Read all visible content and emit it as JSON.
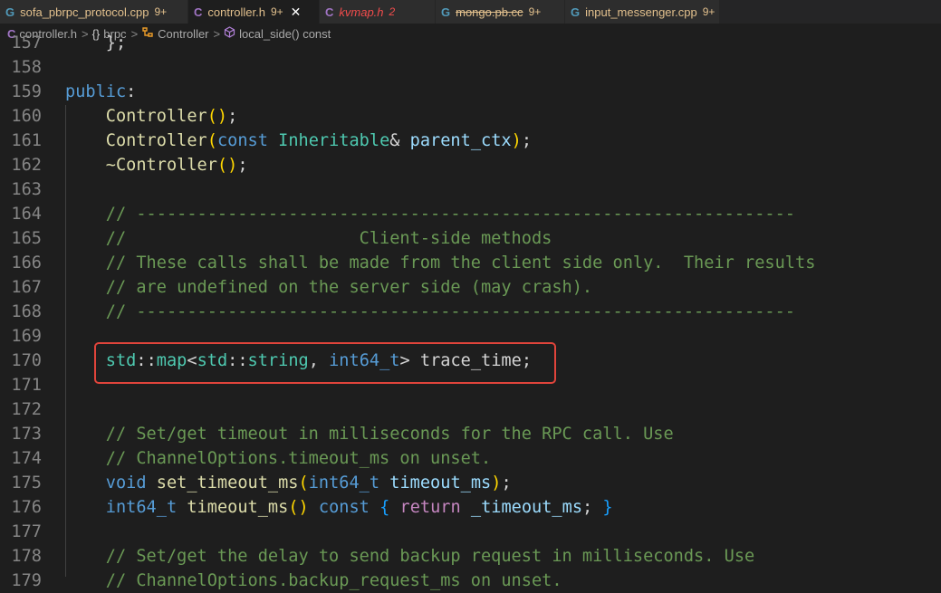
{
  "tabs": [
    {
      "icon": "G",
      "label": "sofa_pbrpc_protocol.cpp",
      "badge": "9+",
      "color": "#e2c08d",
      "icon_color": "#519aba",
      "active": false
    },
    {
      "icon": "C",
      "label": "controller.h",
      "badge": "9+",
      "color": "#e2c08d",
      "icon_color": "#a074c4",
      "active": true,
      "close": "✕"
    },
    {
      "icon": "C",
      "label": "kvmap.h",
      "badge": "2",
      "color": "#f14c4c",
      "icon_color": "#a074c4",
      "italic": true
    },
    {
      "icon": "G",
      "label": "mongo.pb.cc",
      "badge": "9+",
      "color": "#e2c08d",
      "icon_color": "#519aba",
      "strike": true
    },
    {
      "icon": "G",
      "label": "input_messenger.cpp",
      "badge": "9+",
      "color": "#e2c08d",
      "icon_color": "#519aba"
    }
  ],
  "breadcrumb": {
    "file_icon": "C",
    "file": "controller.h",
    "namespace_icon": "{}",
    "namespace": "brpc",
    "class": "Controller",
    "method": "local_side() const",
    "sep": ">"
  },
  "editor": {
    "lines": [
      {
        "n": "157",
        "code": [
          [
            "    ",
            "pu"
          ],
          [
            "};",
            "pu"
          ]
        ]
      },
      {
        "n": "158",
        "code": []
      },
      {
        "n": "159",
        "code": [
          [
            "public",
            "kw"
          ],
          [
            ":",
            "pu"
          ]
        ]
      },
      {
        "n": "160",
        "code": [
          [
            "    ",
            "pu"
          ],
          [
            "Controller",
            "fn"
          ],
          [
            "()",
            "br1"
          ],
          [
            ";",
            "pu"
          ]
        ]
      },
      {
        "n": "161",
        "code": [
          [
            "    ",
            "pu"
          ],
          [
            "Controller",
            "fn"
          ],
          [
            "(",
            "br1"
          ],
          [
            "const",
            "kw"
          ],
          [
            " ",
            "pu"
          ],
          [
            "Inheritable",
            "ty"
          ],
          [
            "& ",
            "pu"
          ],
          [
            "parent_ctx",
            "pm"
          ],
          [
            ")",
            "br1"
          ],
          [
            ";",
            "pu"
          ]
        ]
      },
      {
        "n": "162",
        "code": [
          [
            "    ",
            "pu"
          ],
          [
            "~Controller",
            "fn"
          ],
          [
            "()",
            "br1"
          ],
          [
            ";",
            "pu"
          ]
        ]
      },
      {
        "n": "163",
        "code": []
      },
      {
        "n": "164",
        "code": [
          [
            "    ",
            "pu"
          ],
          [
            "// -----------------------------------------------------------------",
            "cm"
          ]
        ]
      },
      {
        "n": "165",
        "code": [
          [
            "    ",
            "pu"
          ],
          [
            "//                       Client-side methods",
            "cm"
          ]
        ]
      },
      {
        "n": "166",
        "code": [
          [
            "    ",
            "pu"
          ],
          [
            "// These calls shall be made from the client side only.  Their results",
            "cm"
          ]
        ]
      },
      {
        "n": "167",
        "code": [
          [
            "    ",
            "pu"
          ],
          [
            "// are undefined on the server side (may crash).",
            "cm"
          ]
        ]
      },
      {
        "n": "168",
        "code": [
          [
            "    ",
            "pu"
          ],
          [
            "// -----------------------------------------------------------------",
            "cm"
          ]
        ]
      },
      {
        "n": "169",
        "code": []
      },
      {
        "n": "170",
        "code": [
          [
            "    ",
            "pu"
          ],
          [
            "std",
            "ty"
          ],
          [
            "::",
            "pu"
          ],
          [
            "map",
            "ty"
          ],
          [
            "<",
            "pu"
          ],
          [
            "std",
            "ty"
          ],
          [
            "::",
            "pu"
          ],
          [
            "string",
            "ty"
          ],
          [
            ", ",
            "pu"
          ],
          [
            "int64_t",
            "kw"
          ],
          [
            "> ",
            "pu"
          ],
          [
            "trace_time",
            "pu"
          ],
          [
            ";",
            "pu"
          ]
        ]
      },
      {
        "n": "171",
        "code": []
      },
      {
        "n": "172",
        "code": []
      },
      {
        "n": "173",
        "code": [
          [
            "    ",
            "pu"
          ],
          [
            "// Set/get timeout in milliseconds for the RPC call. Use",
            "cm"
          ]
        ]
      },
      {
        "n": "174",
        "code": [
          [
            "    ",
            "pu"
          ],
          [
            "// ChannelOptions.timeout_ms on unset.",
            "cm"
          ]
        ]
      },
      {
        "n": "175",
        "code": [
          [
            "    ",
            "pu"
          ],
          [
            "void",
            "kw"
          ],
          [
            " ",
            "pu"
          ],
          [
            "set_timeout_ms",
            "fn"
          ],
          [
            "(",
            "br1"
          ],
          [
            "int64_t",
            "kw"
          ],
          [
            " ",
            "pu"
          ],
          [
            "timeout_ms",
            "pm"
          ],
          [
            ")",
            "br1"
          ],
          [
            ";",
            "pu"
          ]
        ]
      },
      {
        "n": "176",
        "code": [
          [
            "    ",
            "pu"
          ],
          [
            "int64_t",
            "kw"
          ],
          [
            " ",
            "pu"
          ],
          [
            "timeout_ms",
            "fn"
          ],
          [
            "()",
            "br1"
          ],
          [
            " ",
            "pu"
          ],
          [
            "const",
            "kw"
          ],
          [
            " ",
            "pu"
          ],
          [
            "{",
            "br3"
          ],
          [
            " ",
            "pu"
          ],
          [
            "return",
            "kw2"
          ],
          [
            " ",
            "pu"
          ],
          [
            "_timeout_ms",
            "pm"
          ],
          [
            "; ",
            "pu"
          ],
          [
            "}",
            "br3"
          ]
        ]
      },
      {
        "n": "177",
        "code": []
      },
      {
        "n": "178",
        "code": [
          [
            "    ",
            "pu"
          ],
          [
            "// Set/get the delay to send backup request in milliseconds. Use",
            "cm"
          ]
        ]
      },
      {
        "n": "179",
        "code": [
          [
            "    ",
            "pu"
          ],
          [
            "// ChannelOptions.backup_request_ms on unset.",
            "cm"
          ]
        ]
      }
    ]
  }
}
